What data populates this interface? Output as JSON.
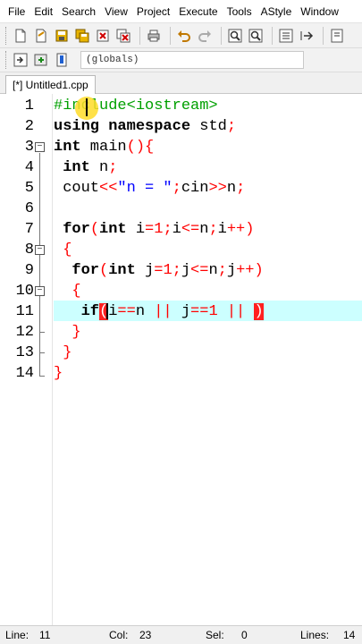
{
  "menu": [
    "File",
    "Edit",
    "Search",
    "View",
    "Project",
    "Execute",
    "Tools",
    "AStyle",
    "Window"
  ],
  "toolbar_icons": [
    "new-file-icon",
    "open-icon",
    "save-icon",
    "save-all-icon",
    "close-icon",
    "close-all-icon",
    "print-icon",
    "undo-icon",
    "redo-icon",
    "find-icon",
    "replace-icon",
    "indent-icon",
    "unindent-icon",
    "bookmark-icon"
  ],
  "toolbar2": {
    "globals_value": "(globals)"
  },
  "tab": {
    "label": "[*] Untitled1.cpp"
  },
  "line_numbers": [
    "1",
    "2",
    "3",
    "4",
    "5",
    "6",
    "7",
    "8",
    "9",
    "10",
    "11",
    "12",
    "13",
    "14"
  ],
  "code": {
    "l1_hash": "#in",
    "l1_rest": "clude<iostream>",
    "l2_using": "using",
    "l2_namespace": "namespace",
    "l2_std": " std",
    "l2_semi": ";",
    "l3_int": "int",
    "l3_main": " main",
    "l3_paren": "(){",
    "l4_int": "int",
    "l4_n": " n",
    "l4_semi": ";",
    "l5_cout": "cout",
    "l5_op": "<<",
    "l5_str": "\"n = \"",
    "l5_semi": ";",
    "l5_cin": "cin",
    "l5_op2": ">>",
    "l5_n": "n",
    "l5_semi2": ";",
    "l7_for": "for",
    "l7_open": "(",
    "l7_int": "int",
    "l7_i": " i",
    "l7_eq": "=",
    "l7_one": "1",
    "l7_semi": ";",
    "l7_i2": "i",
    "l7_le": "<=",
    "l7_n": "n",
    "l7_semi2": ";",
    "l7_i3": "i",
    "l7_inc": "++)",
    "l8_brace": "{",
    "l9_for": "for",
    "l9_open": "(",
    "l9_int": "int",
    "l9_j": " j",
    "l9_eq": "=",
    "l9_one": "1",
    "l9_semi": ";",
    "l9_j2": "j",
    "l9_le": "<=",
    "l9_n": "n",
    "l9_semi2": ";",
    "l9_j3": "j",
    "l9_inc": "++)",
    "l10_brace": "{",
    "l11_if": "if",
    "l11_open": "(",
    "l11_i": "i",
    "l11_eqeq": "==",
    "l11_n": "n ",
    "l11_or": "||",
    "l11_j": " j",
    "l11_eqeq2": "==",
    "l11_one": "1",
    "l11_or2": " || ",
    "l11_close": ")",
    "l12_brace": "}",
    "l13_brace": "}",
    "l14_brace": "}"
  },
  "status": {
    "line_label": "Line:",
    "line_value": "11",
    "col_label": "Col:",
    "col_value": "23",
    "sel_label": "Sel:",
    "sel_value": "0",
    "lines_label": "Lines:",
    "lines_value": "14"
  },
  "colors": {
    "keyword": "#000000",
    "number_symbol": "#ff0000",
    "preprocessor": "#00a000",
    "string": "#0000ff",
    "current_line": "#ccffff",
    "brace_mismatch": "#ff2020"
  }
}
